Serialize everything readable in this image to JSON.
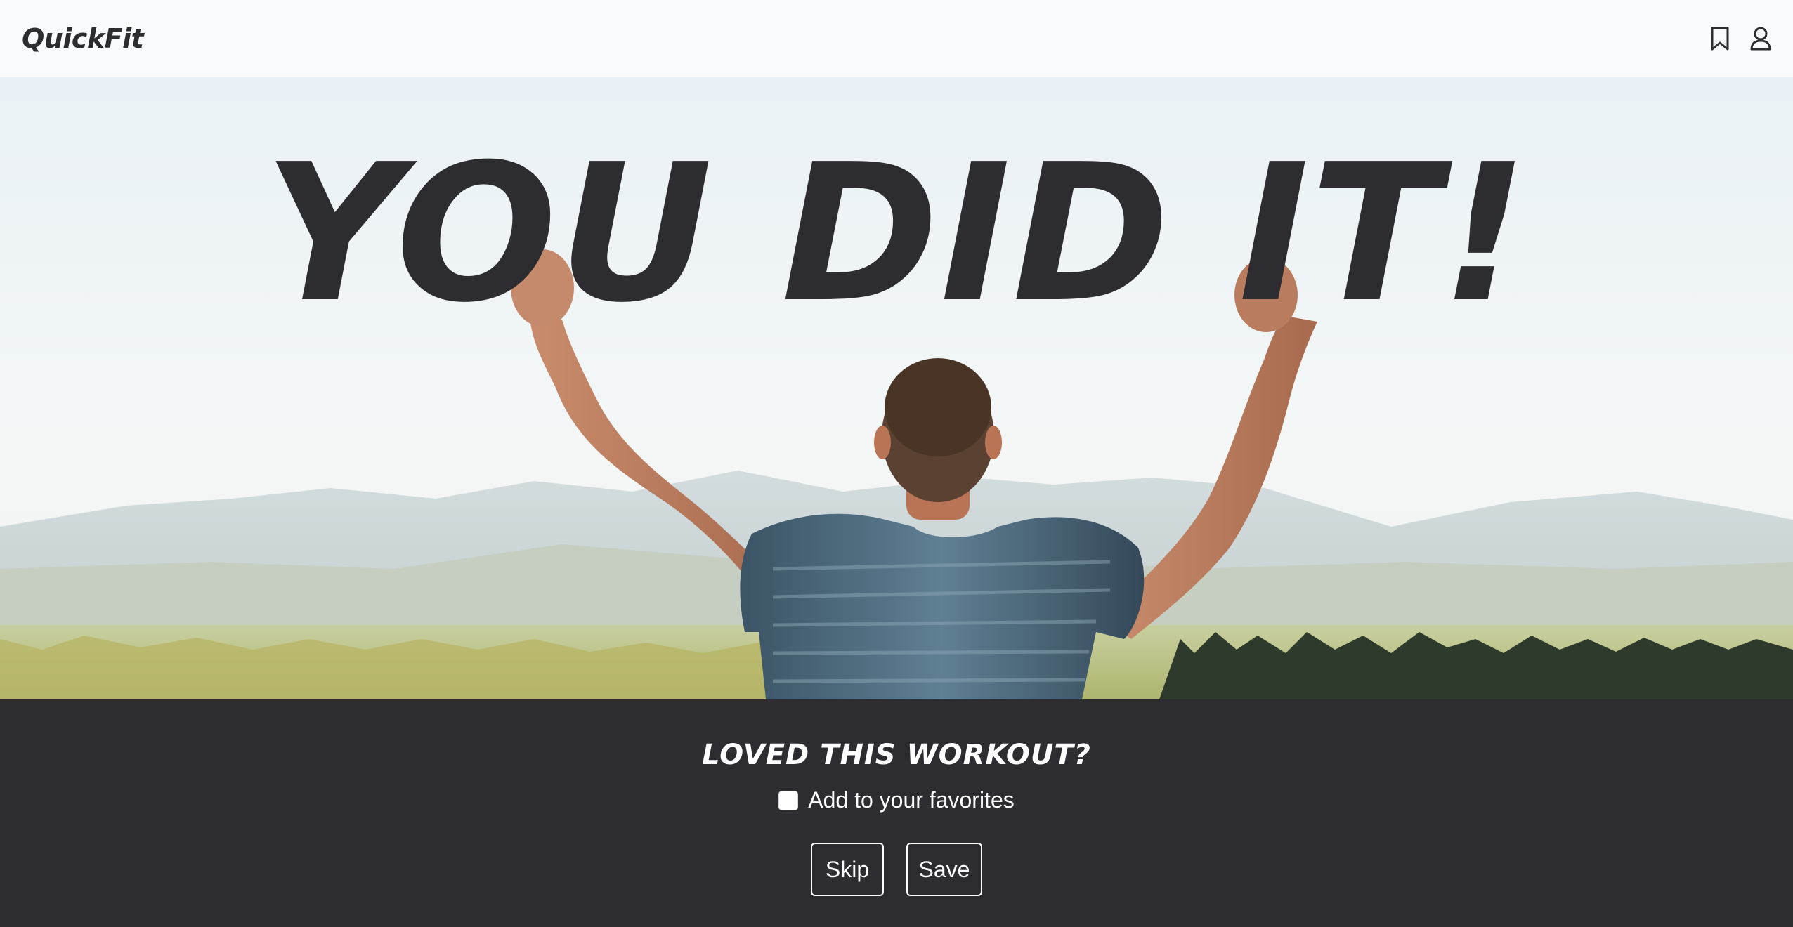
{
  "header": {
    "logo": "QuickFit",
    "icons": [
      "bookmark-icon",
      "user-icon"
    ]
  },
  "hero": {
    "headline": "YOU DID IT!"
  },
  "footer": {
    "title": "LOVED THIS WORKOUT?",
    "favorite_label": "Add to your favorites",
    "favorite_checked": false,
    "skip_label": "Skip",
    "save_label": "Save"
  },
  "colors": {
    "dark": "#2d2c30",
    "header_bg": "#f8fafc",
    "white": "#ffffff"
  }
}
